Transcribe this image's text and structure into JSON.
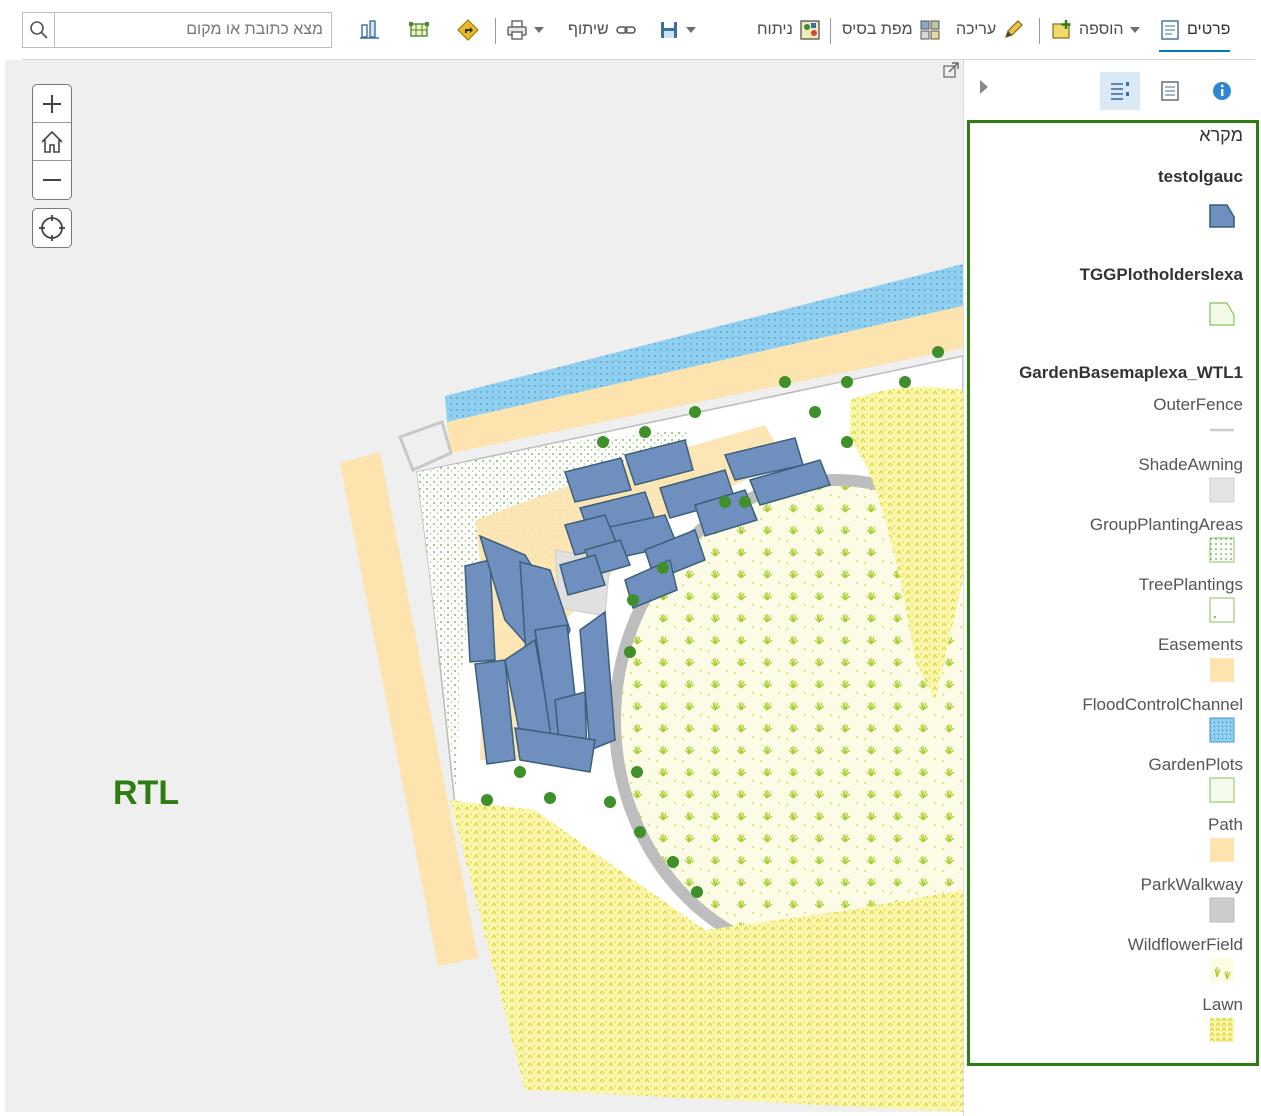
{
  "toolbar": {
    "details_label": "פרטים",
    "add_label": "הוספה",
    "edit_label": "עריכה",
    "basemap_label": "מפת בסיס",
    "analysis_label": "ניתוח",
    "share_label": "שיתוף",
    "search_placeholder": "מצא כתובת או מקום",
    "accent_color": "#0079c1"
  },
  "map": {
    "overlay_text": "RTL",
    "overlay_color": "#2e7d12",
    "controls": [
      "zoom-in-icon",
      "home-icon",
      "zoom-out-icon",
      "locate-icon"
    ]
  },
  "panel": {
    "tabs": [
      "about-icon",
      "content-icon",
      "legend-icon"
    ],
    "legend": {
      "title": "מקרא",
      "layers": [
        {
          "name": "testolgauc",
          "entries": [
            {
              "label": "",
              "color": "#6f8fbf"
            }
          ]
        },
        {
          "name": "TGGPlotholderslexa",
          "entries": [
            {
              "label": "",
              "color": "#f2f9e6"
            }
          ]
        },
        {
          "name": "GardenBasemaplexa_WTL1",
          "entries": [
            {
              "label": "OuterFence",
              "color": "#d0d0d0"
            },
            {
              "label": "ShadeAwning",
              "color": "#e3e3e3"
            },
            {
              "label": "GroupPlantingAreas",
              "color": "#e7f3d8"
            },
            {
              "label": "TreePlantings",
              "color": "#ffffff"
            },
            {
              "label": "Easements",
              "color": "#fde3ad"
            },
            {
              "label": "FloodControlChannel",
              "color": "#8fd0f0"
            },
            {
              "label": "GardenPlots",
              "color": "#f4faec"
            },
            {
              "label": "Path",
              "color": "#fde3ad"
            },
            {
              "label": "ParkWalkway",
              "color": "#cccccc"
            },
            {
              "label": "WildflowerField",
              "color": "#f3f8dc"
            },
            {
              "label": "Lawn",
              "color": "#f4f08a"
            }
          ]
        }
      ]
    }
  }
}
